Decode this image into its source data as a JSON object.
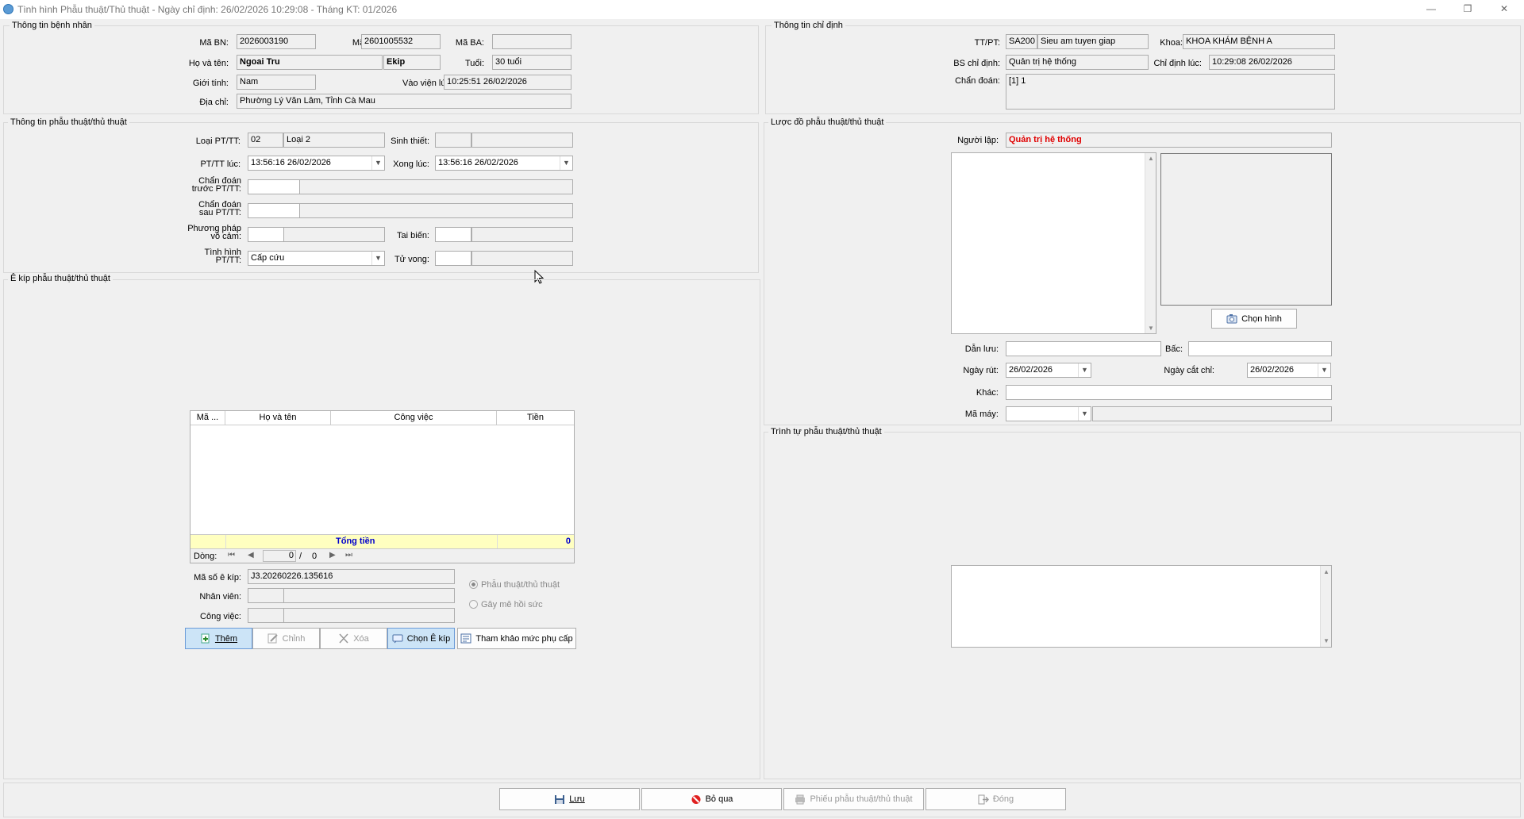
{
  "window": {
    "title": "Tình hình Phẫu thuật/Thủ thuật - Ngày chỉ định: 26/02/2026 10:29:08 - Tháng KT: 01/2026",
    "minimize": "—",
    "maximize": "❐",
    "close": "✕"
  },
  "patient": {
    "group_title": "Thông tin bệnh nhân",
    "ma_bn_label": "Mã BN:",
    "ma_bn": "2026003190",
    "ma_kb_label": "Mã KB:",
    "ma_kb": "2601005532",
    "ma_ba_label": "Mã BA:",
    "ma_ba": "",
    "ho_ten_label": "Họ và tên:",
    "ho_ten": "Ngoai Tru",
    "ekip": "Ekip",
    "tuoi_label": "Tuổi:",
    "tuoi": "30 tuổi",
    "gioi_tinh_label": "Giới tính:",
    "gioi_tinh": "Nam",
    "vao_vien_label": "Vào viện lúc:",
    "vao_vien": "10:25:51  26/02/2026",
    "dia_chi_label": "Địa chỉ:",
    "dia_chi": "Phường Lý Văn Lâm, Tỉnh Cà Mau"
  },
  "order": {
    "group_title": "Thông tin chỉ định",
    "tt_pt_label": "TT/PT:",
    "tt_pt_code": "SA200",
    "tt_pt_name": "Sieu am tuyen giap",
    "khoa_label": "Khoa:",
    "khoa": "KHOA KHÁM BỆNH A",
    "bs_label": "BS chỉ định:",
    "bs": "Quản trị hệ thống",
    "chi_dinh_luc_label": "Chỉ định lúc:",
    "chi_dinh_luc": "10:29:08  26/02/2026",
    "chan_doan_label": "Chẩn đoán:",
    "chan_doan": "[1] 1"
  },
  "surgery": {
    "group_title": "Thông tin phẫu thuật/thủ thuật",
    "loai_label": "Loại PT/TT:",
    "loai_code": "02",
    "loai_name": "Loại 2",
    "sinh_thiet_label": "Sinh thiết:",
    "pt_luc_label": "PT/TT lúc:",
    "pt_luc": "13:56:16  26/02/2026",
    "xong_luc_label": "Xong lúc:",
    "xong_luc": "13:56:16  26/02/2026",
    "cd_truoc_label_1": "Chẩn đoán",
    "cd_truoc_label_2": "trước PT/TT:",
    "cd_sau_label_1": "Chẩn đoán",
    "cd_sau_label_2": "sau PT/TT:",
    "pp_label_1": "Phương pháp",
    "pp_label_2": "vô cảm:",
    "tai_bien_label": "Tai biến:",
    "tinh_hinh_label_1": "Tình hình",
    "tinh_hinh_label_2": "PT/TT:",
    "tinh_hinh": "Cấp cứu",
    "tu_vong_label": "Tử vong:"
  },
  "team": {
    "group_title": "Ê kíp phẫu thuật/thủ thuật",
    "columns": [
      "Mã ...",
      "Họ và tên",
      "Công việc",
      "Tiền"
    ],
    "total_label": "Tổng tiền",
    "total_value": "0",
    "nav_label": "Dòng:",
    "nav_current": "0",
    "nav_sep": "/",
    "nav_total": "0",
    "ma_so_label": "Mã số ê kíp:",
    "ma_so": "J3.20260226.135616",
    "nhan_vien_label": "Nhân viên:",
    "cong_viec_label": "Công việc:",
    "radio_pttt": "Phẫu thuật/thủ thuật",
    "radio_gmhs": "Gây mê hồi sức",
    "btn_them": "Thêm",
    "btn_chinh": "Chỉnh",
    "btn_xoa": "Xóa",
    "btn_chon": "Chọn Ê kíp",
    "btn_tham_khao": "Tham khảo mức phụ cấp"
  },
  "diagram": {
    "group_title": "Lược đồ phẫu thuật/thủ thuật",
    "nguoi_lap_label": "Người lập:",
    "nguoi_lap": "Quản trị hệ thống",
    "chon_hinh": "Chọn hình",
    "dan_luu_label": "Dẫn lưu:",
    "bac_label": "Bấc:",
    "ngay_rut_label": "Ngày rút:",
    "ngay_rut": "26/02/2026",
    "ngay_cat_chi_label": "Ngày cắt chỉ:",
    "ngay_cat_chi": "26/02/2026",
    "khac_label": "Khác:",
    "ma_may_label": "Mã máy:"
  },
  "sequence": {
    "group_title": "Trình tự phẫu thuật/thủ thuật"
  },
  "footer": {
    "luu": "Lưu",
    "bo_qua": "Bỏ qua",
    "phieu": "Phiếu phẫu thuật/thủ thuật",
    "dong": "Đóng"
  }
}
